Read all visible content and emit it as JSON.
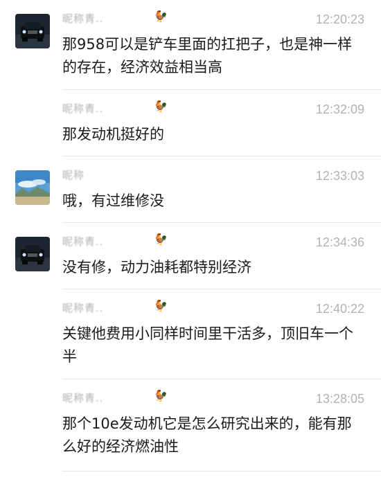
{
  "messages": [
    {
      "sender": "昵称青..",
      "sender_emoji": "🐓",
      "time": "12:20:23",
      "text": "那958可以是铲车里面的扛把子，也是神一样的存在，经济效益相当高",
      "avatar": "truck-avatar"
    },
    {
      "sender": "昵称青..",
      "sender_emoji": "🐓",
      "time": "12:32:09",
      "text": "那发动机挺好的",
      "avatar": ""
    },
    {
      "sender": "昵称",
      "sender_emoji": "",
      "time": "12:33:03",
      "text": "哦，有过维修没",
      "avatar": "landscape-avatar"
    },
    {
      "sender": "昵称青..",
      "sender_emoji": "🐓",
      "time": "12:34:36",
      "text": "没有修，动力油耗都特别经济",
      "avatar": "truck-avatar"
    },
    {
      "sender": "昵称青..",
      "sender_emoji": "🐓",
      "time": "12:40:22",
      "text": "关键他费用小同样时间里干活多，顶旧车一个半",
      "avatar": ""
    },
    {
      "sender": "昵称青..",
      "sender_emoji": "🐓",
      "time": "13:28:05",
      "text": "那个10e发动机它是怎么研究出来的，能有那么好的经济燃油性",
      "avatar": ""
    }
  ]
}
